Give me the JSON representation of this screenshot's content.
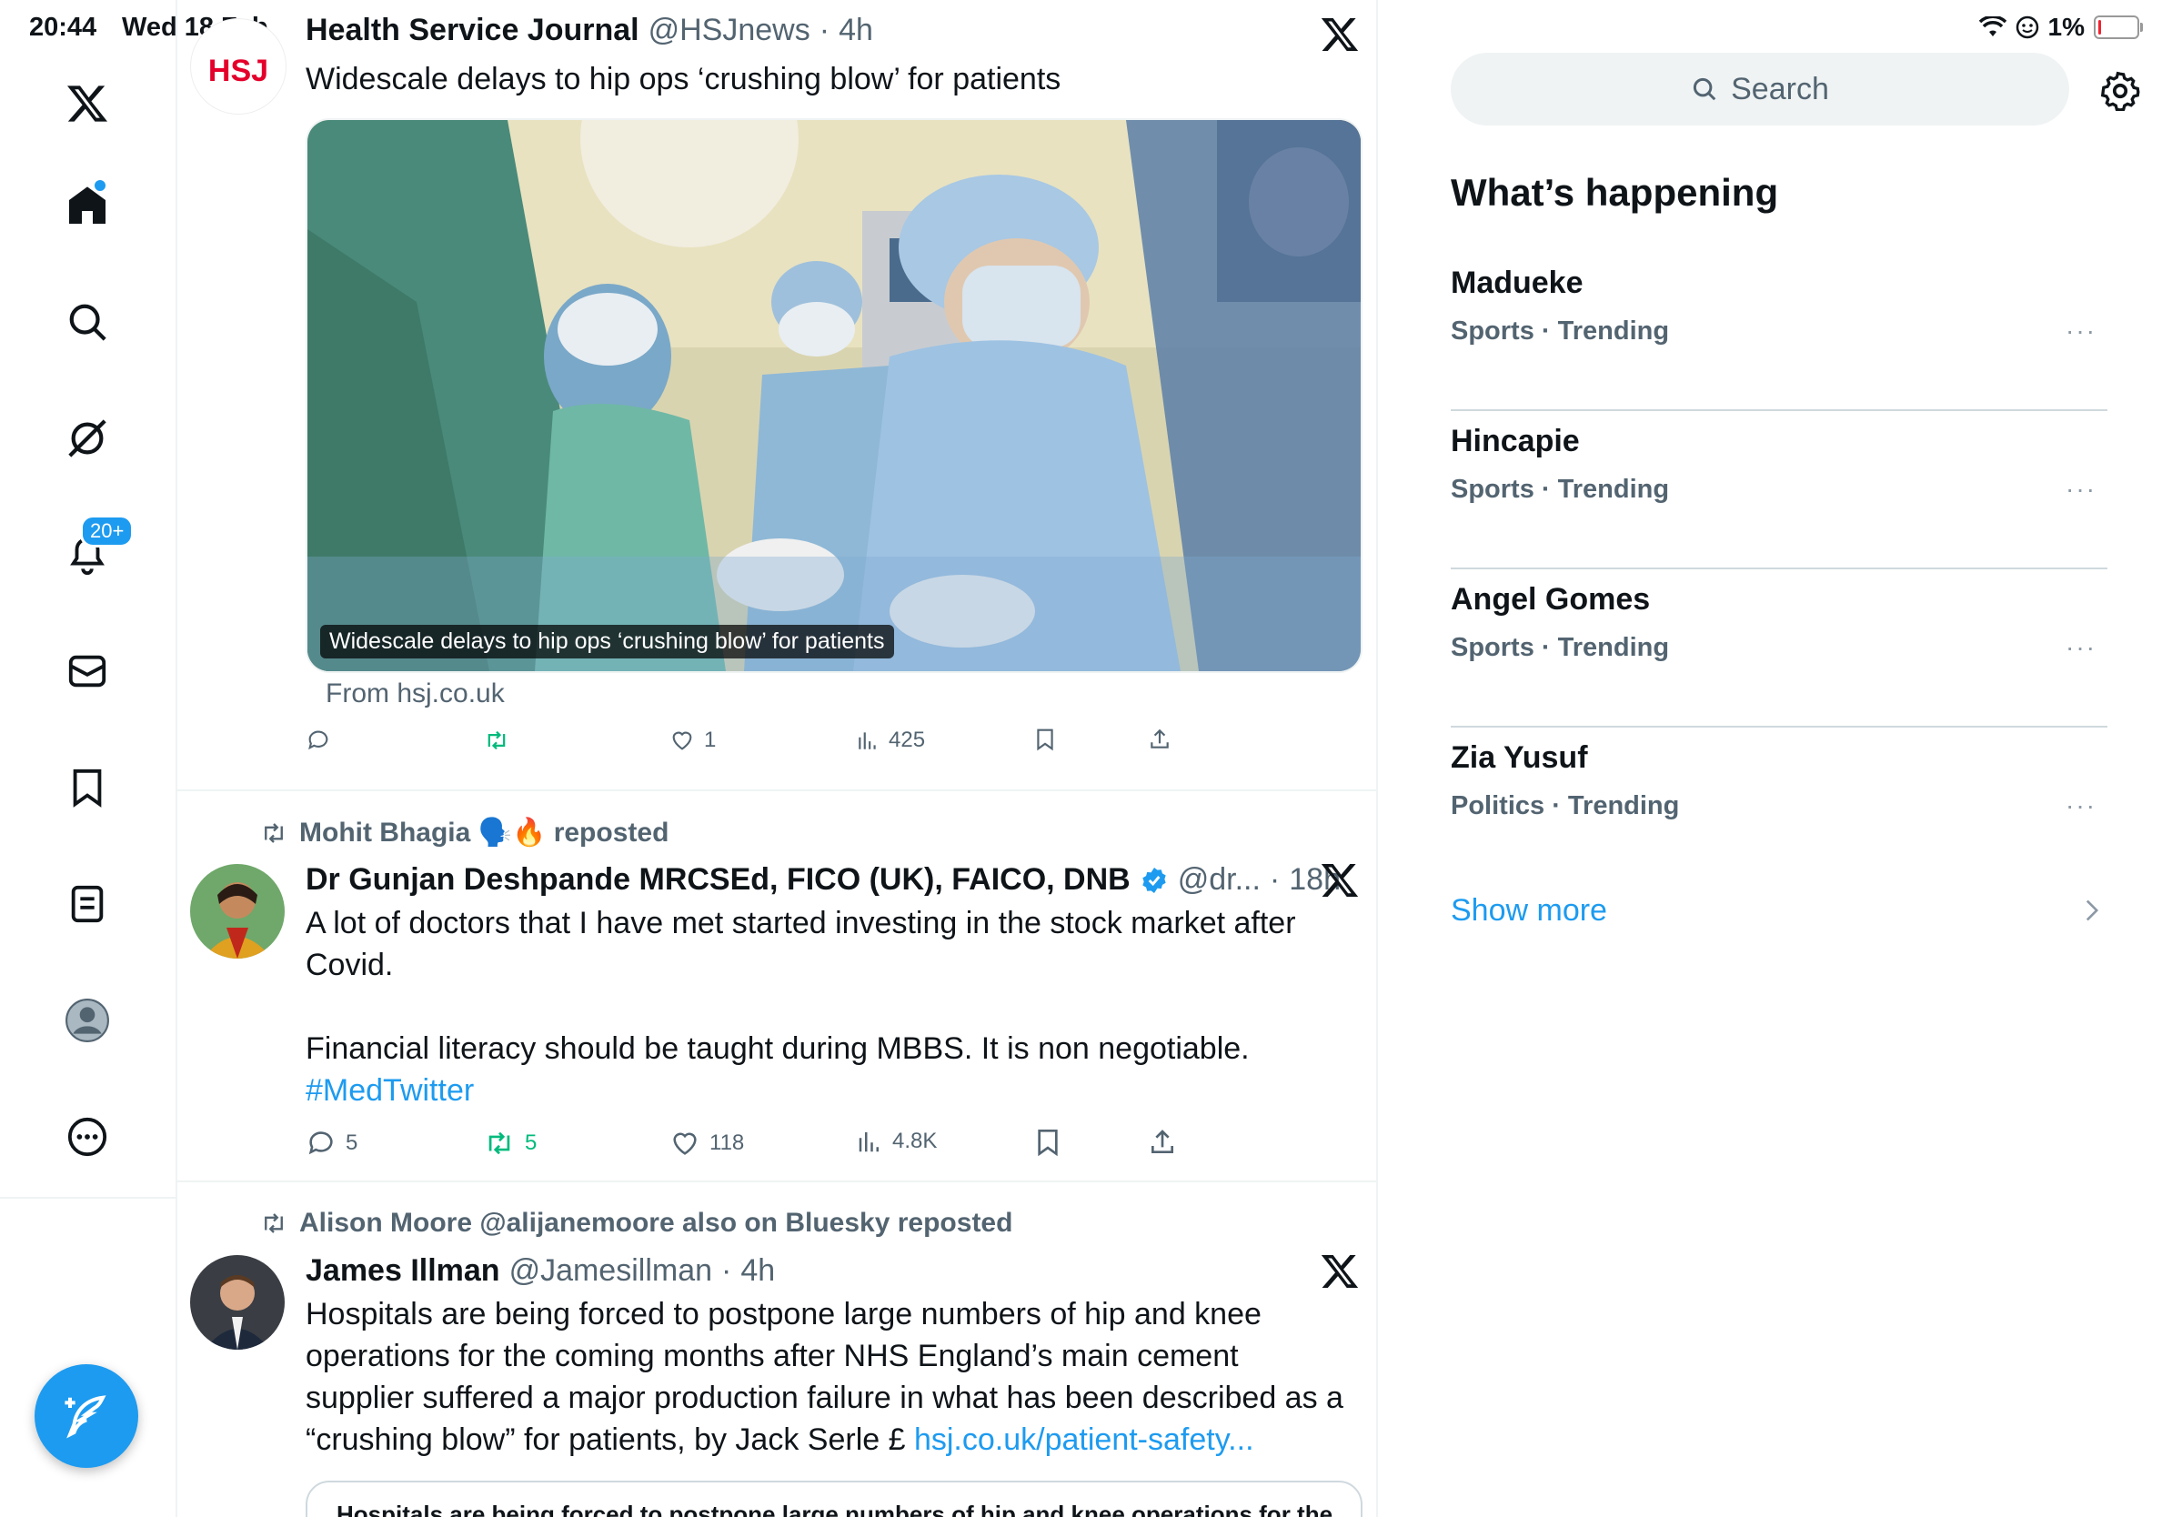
{
  "status_bar": {
    "time": "20:44",
    "date": "Wed 18 Feb",
    "battery": "1%"
  },
  "nav": {
    "notifications_badge": "20+"
  },
  "tweets": [
    {
      "name": "Health Service Journal",
      "handle": "@HSJnews",
      "time": "4h",
      "text": "Widescale delays to hip ops ‘crushing blow’ for patients",
      "avatar_text": "HSJ",
      "media_caption": "Widescale delays to hip ops ‘crushing blow’ for patients",
      "from": "From hsj.co.uk",
      "replies": "",
      "retweets": "",
      "likes": "1",
      "views": "425"
    },
    {
      "repost_by": "Mohit Bhagia 🗣️🔥 reposted",
      "name": "Dr Gunjan Deshpande MRCSEd, FICO (UK), FAICO, DNB",
      "handle": "@dr...",
      "time": "18h",
      "text_line1": "A lot of doctors that I have met started investing in the stock market after Covid.",
      "text_line2": "Financial literacy should be taught during MBBS. It is non negotiable.",
      "hashtag": "#MedTwitter",
      "replies": "5",
      "retweets": "5",
      "likes": "118",
      "views": "4.8K"
    },
    {
      "repost_by": "Alison Moore @alijanemoore also on Bluesky reposted",
      "name": "James Illman",
      "handle": "@Jamesillman",
      "time": "4h",
      "text": "Hospitals are being forced to postpone large numbers of hip and knee operations for the coming months after NHS England’s main cement supplier suffered a major production failure in what has been described as a “crushing blow” for patients, by Jack Serle £",
      "link": "hsj.co.uk/patient-safety...",
      "card_preview": "Hospitals are being forced to postpone large numbers of hip and knee operations for the"
    }
  ],
  "right": {
    "search_placeholder": "Search",
    "title": "What’s happening",
    "trends": [
      {
        "name": "Madueke",
        "category": "Sports · Trending"
      },
      {
        "name": "Hincapie",
        "category": "Sports · Trending"
      },
      {
        "name": "Angel Gomes",
        "category": "Sports · Trending"
      },
      {
        "name": "Zia Yusuf",
        "category": "Politics · Trending"
      }
    ],
    "more_glyph": "···",
    "show_more": "Show more"
  },
  "colors": {
    "accent": "#1d9bf0",
    "retweet": "#00ba7c",
    "muted": "#536471"
  }
}
